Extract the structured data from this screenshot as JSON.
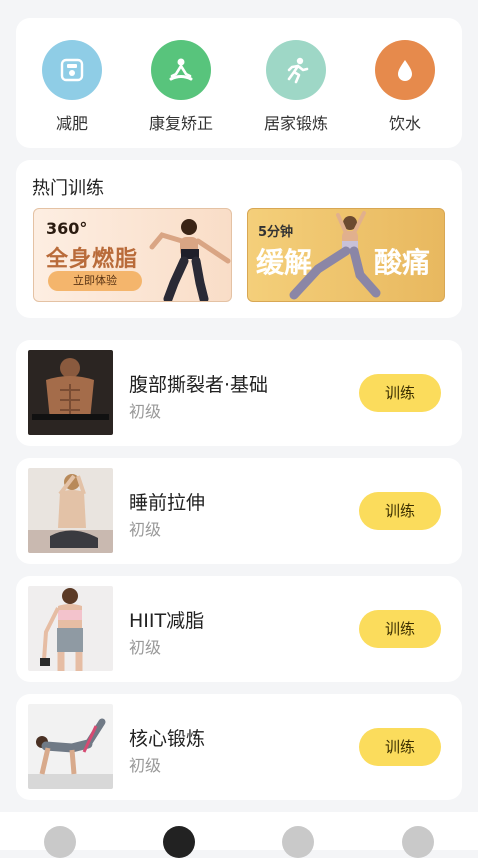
{
  "categories": [
    {
      "label": "减肥",
      "icon": "scale-icon",
      "color": "#8fcde6"
    },
    {
      "label": "康复矫正",
      "icon": "meditation-icon",
      "color": "#58c47c"
    },
    {
      "label": "居家锻炼",
      "icon": "running-icon",
      "color": "#9ed7c6"
    },
    {
      "label": "饮水",
      "icon": "water-drop-icon",
      "color": "#e68a4c"
    }
  ],
  "hot": {
    "title": "热门训练",
    "banner1": {
      "top": "360°",
      "main": "全身燃脂",
      "button": "立即体验"
    },
    "banner2": {
      "top": "5分钟",
      "main1": "缓解",
      "main2": "酸痛"
    }
  },
  "trainings": [
    {
      "name": "腹部撕裂者·基础",
      "level": "初级",
      "button": "训练"
    },
    {
      "name": "睡前拉伸",
      "level": "初级",
      "button": "训练"
    },
    {
      "name": "HIIT减脂",
      "level": "初级",
      "button": "训练"
    },
    {
      "name": "核心锻炼",
      "level": "初级",
      "button": "训练"
    }
  ],
  "nav": {
    "colors": {
      "inactive": "#c9c9c9",
      "active": "#222222"
    },
    "items": [
      "home-icon",
      "fitness-icon",
      "plan-icon",
      "profile-icon"
    ]
  }
}
